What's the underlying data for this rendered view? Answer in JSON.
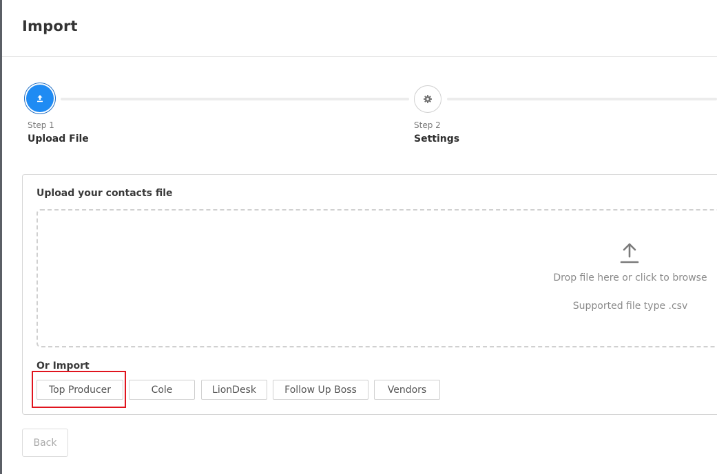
{
  "header": {
    "title": "Import"
  },
  "stepper": {
    "steps": [
      {
        "number_label": "Step 1",
        "name": "Upload File",
        "icon": "upload-icon",
        "state": "active"
      },
      {
        "number_label": "Step 2",
        "name": "Settings",
        "icon": "gear-icon",
        "state": "inactive"
      }
    ]
  },
  "upload": {
    "title": "Upload your contacts file",
    "drop_text": "Drop file here or click to browse",
    "supported_text": "Supported file type .csv",
    "icon": "upload-arrow-icon"
  },
  "or_import": {
    "label": "Or Import",
    "buttons": [
      "Top Producer",
      "Cole",
      "LionDesk",
      "Follow Up Boss",
      "Vendors"
    ]
  },
  "footer": {
    "back_label": "Back"
  },
  "colors": {
    "accent": "#1f8bf3",
    "highlight": "#e0141e"
  }
}
